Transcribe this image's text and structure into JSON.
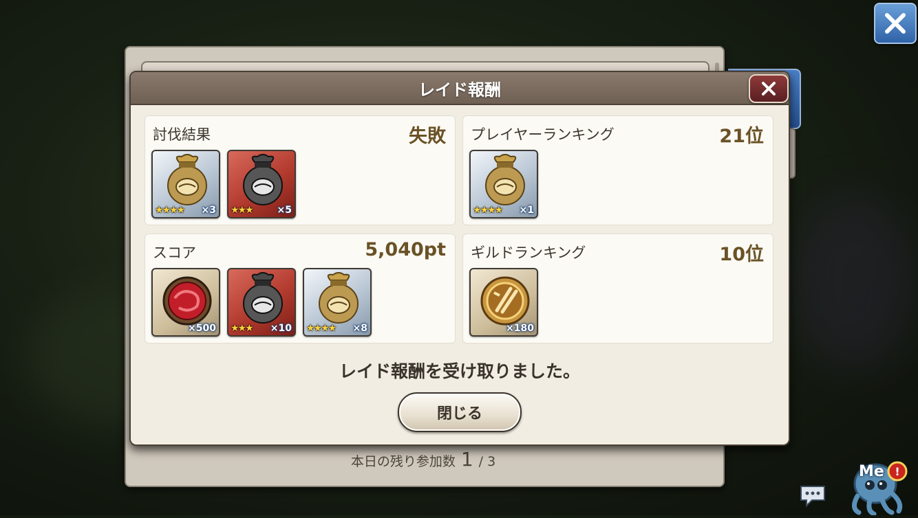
{
  "dialog": {
    "title": "レイド報酬",
    "received_message": "レイド報酬を受け取りました。",
    "close_button_label": "閉じる"
  },
  "sections": [
    {
      "title": "討伐結果",
      "value": "失敗",
      "items": [
        {
          "icon": "silver-pouch-icon",
          "style": "silver",
          "stars": "★★★★",
          "qty": "×3"
        },
        {
          "icon": "dark-pouch-icon",
          "style": "red",
          "stars": "★★★",
          "qty": "×5"
        }
      ]
    },
    {
      "title": "プレイヤーランキング",
      "value": "21位",
      "items": [
        {
          "icon": "silver-pouch-icon",
          "style": "silver",
          "stars": "★★★★",
          "qty": "×1"
        }
      ]
    },
    {
      "title": "スコア",
      "value": "5,040pt",
      "items": [
        {
          "icon": "red-gem-icon",
          "style": "tan",
          "stars": "",
          "qty": "×500"
        },
        {
          "icon": "dark-pouch-icon",
          "style": "red",
          "stars": "★★★",
          "qty": "×10"
        },
        {
          "icon": "silver-pouch-icon",
          "style": "silver",
          "stars": "★★★★",
          "qty": "×8"
        }
      ]
    },
    {
      "title": "ギルドランキング",
      "value": "10位",
      "items": [
        {
          "icon": "guild-medal-icon",
          "style": "tan",
          "stars": "",
          "qty": "×180"
        }
      ]
    }
  ],
  "footer": {
    "remaining_label": "本日の残り参加数",
    "remaining_count": "1",
    "remaining_total": "/ 3"
  },
  "mascot": {
    "label": "Me"
  },
  "colors": {
    "accent_blue": "#2f63a8",
    "value_brown": "#6a5226",
    "header_brown": "#7a6b5e"
  }
}
